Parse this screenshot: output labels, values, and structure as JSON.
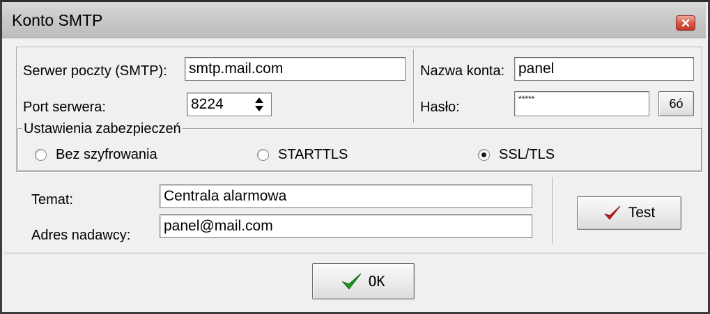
{
  "window": {
    "title": "Konto SMTP"
  },
  "server": {
    "smtp_label": "Serwer poczty (SMTP):",
    "smtp_value": "smtp.mail.com",
    "port_label": "Port serwera:",
    "port_value": "8224"
  },
  "account": {
    "name_label": "Nazwa konta:",
    "name_value": "panel",
    "password_label": "Hasło:",
    "password_value": "*****",
    "show_password_label": "6ó"
  },
  "security": {
    "legend": "Ustawienia zabezpieczeń",
    "options": [
      {
        "label": "Bez szyfrowania",
        "selected": false
      },
      {
        "label": "STARTTLS",
        "selected": false
      },
      {
        "label": "SSL/TLS",
        "selected": true
      }
    ]
  },
  "message": {
    "subject_label": "Temat:",
    "subject_value": "Centrala alarmowa",
    "sender_label": "Adres nadawcy:",
    "sender_value": "panel@mail.com"
  },
  "buttons": {
    "test_label": "Test",
    "ok_label": "OK"
  },
  "colors": {
    "check_green": "#1e9a1e",
    "check_red": "#d01818"
  }
}
